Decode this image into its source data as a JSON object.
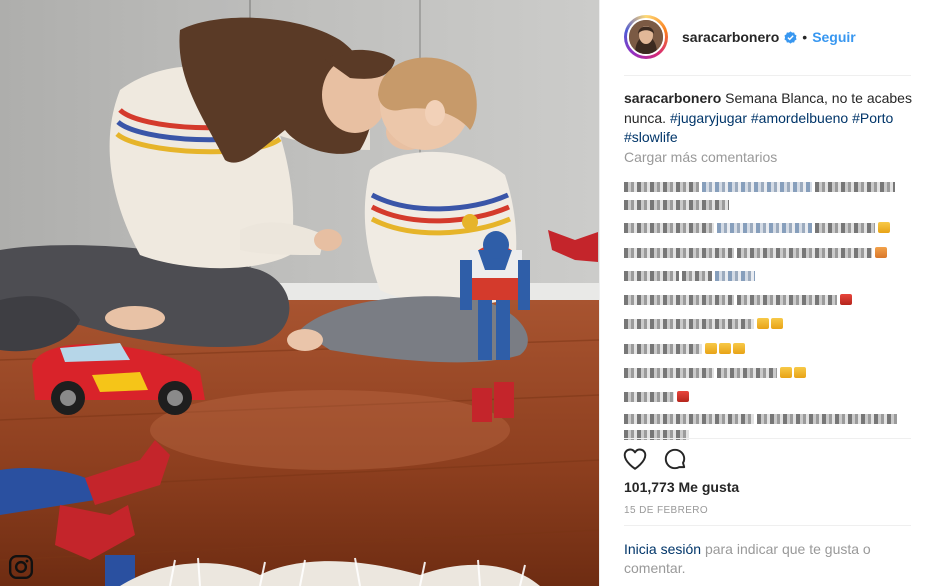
{
  "post": {
    "username": "saracarbonero",
    "dot": "•",
    "follow_label": "Seguir",
    "caption": {
      "username": "saracarbonero",
      "text": "Semana Blanca, no te acabes nunca.",
      "hashtags": [
        "#jugaryjugar",
        "#amordelbueno",
        "#Porto",
        "#slowlife"
      ]
    },
    "load_more_label": "Cargar más comentarios",
    "likes": "101,773 Me gusta",
    "date": "15 DE FEBRERO",
    "login_prompt": {
      "link": "Inicia sesión",
      "text": "para indicar que te gusta o comentar."
    }
  },
  "icons": {
    "verified": "verified-badge-icon",
    "like": "heart-outline-icon",
    "comment": "comment-bubble-icon",
    "instagram": "instagram-glyph-icon"
  },
  "colors": {
    "link_blue": "#3897f0",
    "hashtag_navy": "#003569",
    "muted": "#999999",
    "text": "#262626"
  }
}
